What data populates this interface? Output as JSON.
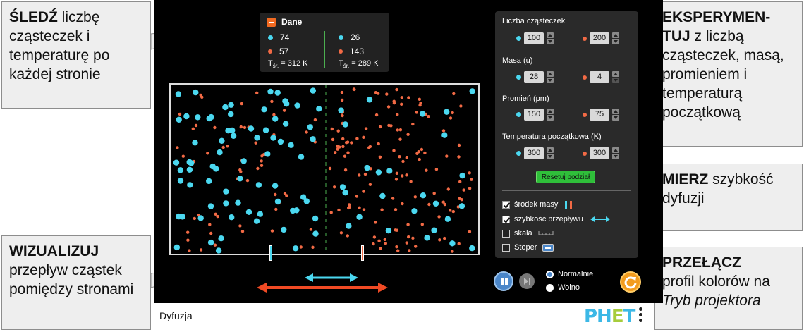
{
  "callouts": {
    "track": {
      "bold": "ŚLEDŹ",
      "text": " liczbę cząsteczek i temperaturę po każdej stronie"
    },
    "visualize": {
      "bold": "WIZUALIZUJ",
      "text": "przepływ cząstek pomiędzy stronami"
    },
    "experiment": {
      "bold": "EKSPERYMEN-TUJ",
      "text": " z liczbą cząsteczek, masą, promieniem i temperaturą początkową"
    },
    "measure": {
      "bold": "MIERZ",
      "text": " szybkość dyfuzji"
    },
    "toggle": {
      "bold": "PRZEŁĄCZ",
      "text": "profil kolorów na ",
      "italic": "Tryb projektora"
    }
  },
  "data_panel": {
    "title": "Dane",
    "left": {
      "cyan_count": "74",
      "red_count": "57",
      "temp_label": "T",
      "temp_sub": "śr.",
      "temp_value": " = 312 K"
    },
    "right": {
      "cyan_count": "26",
      "red_count": "143",
      "temp_label": "T",
      "temp_sub": "śr.",
      "temp_value": " = 289 K"
    }
  },
  "controls": {
    "count_label": "Liczba cząsteczek",
    "count_cyan": "100",
    "count_red": "200",
    "mass_label": "Masa (u)",
    "mass_cyan": "28",
    "mass_red": "4",
    "radius_label": "Promień (pm)",
    "radius_cyan": "150",
    "radius_red": "75",
    "temp_label": "Temperatura początkowa (K)",
    "temp_cyan": "300",
    "temp_red": "300",
    "reset_label": "Resetuj podział",
    "checkboxes": {
      "center_of_mass": {
        "label": "środek masy",
        "checked": true
      },
      "flow_rate": {
        "label": "szybkość przepływu",
        "checked": true
      },
      "scale": {
        "label": "skala",
        "checked": false
      },
      "stopwatch": {
        "label": "Stoper",
        "checked": false
      }
    }
  },
  "speed": {
    "normal": "Normalnie",
    "slow": "Wolno",
    "selected": "normal"
  },
  "navbar": {
    "title": "Dyfuzja",
    "logo_p": "PH",
    "logo_e": "E",
    "logo_t": "T"
  },
  "colors": {
    "cyan_particle": "#4bd8f0",
    "red_particle": "#f26a45",
    "accent_orange": "#f26a21",
    "divider_green": "#4caf50"
  }
}
